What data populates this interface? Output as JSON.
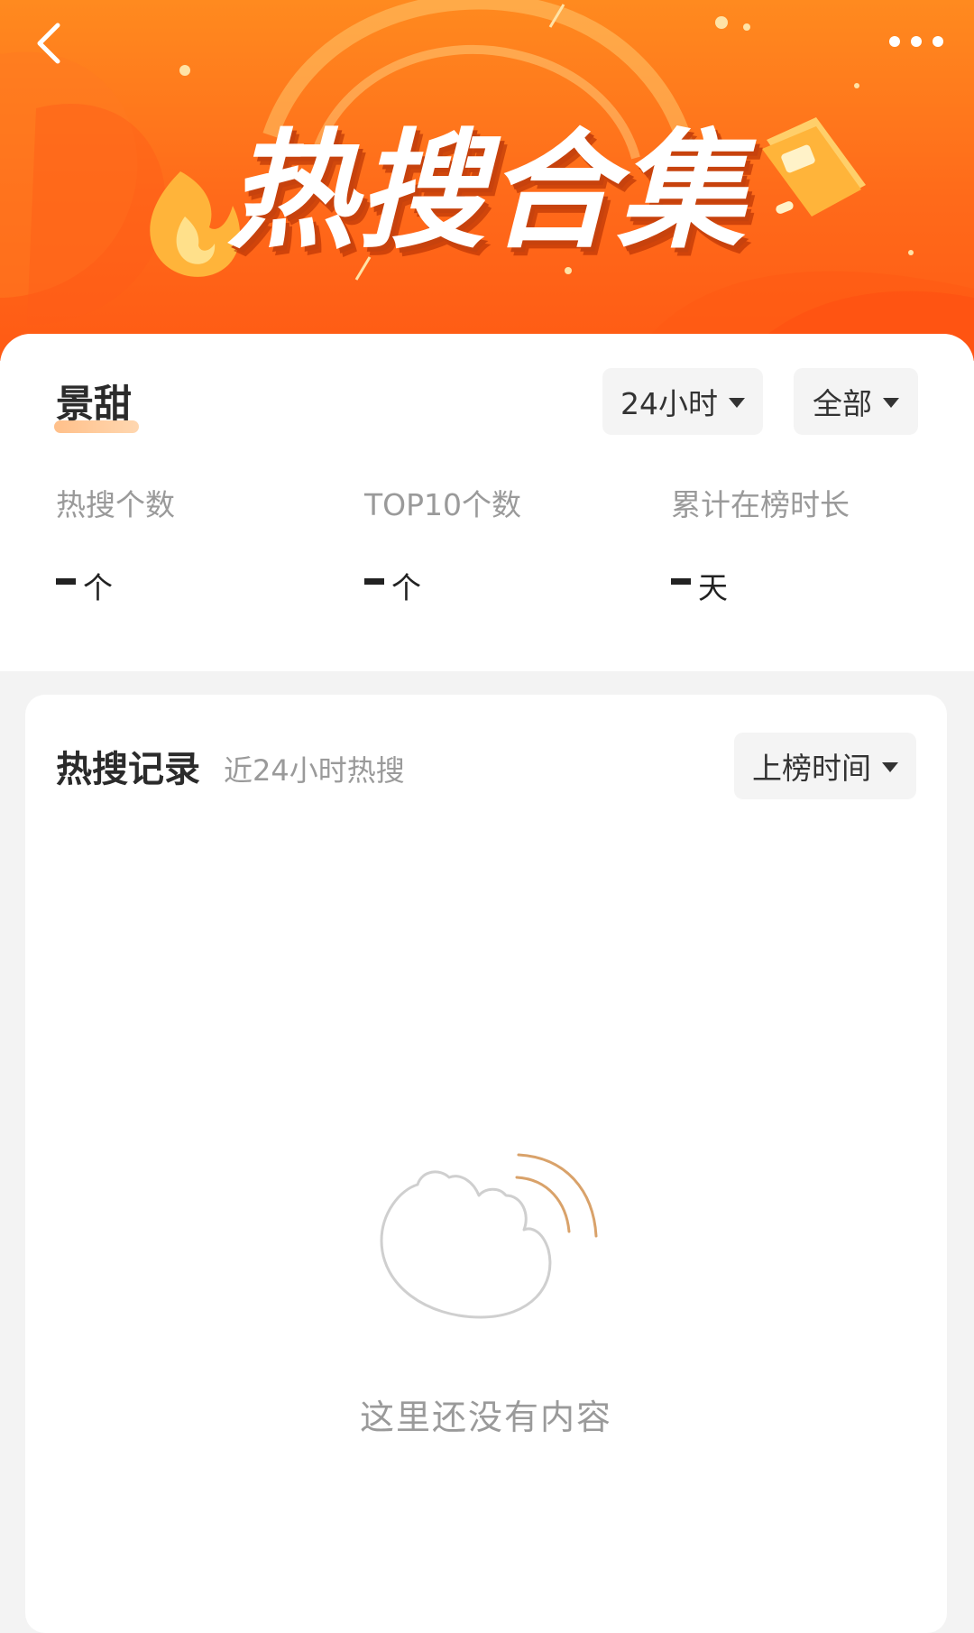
{
  "colors": {
    "brand_orange": "#ff6a1a",
    "banner_light": "#ff8a1f",
    "text_primary": "#222222",
    "text_secondary": "#9a9a9a",
    "dropdown_bg": "#f4f4f4",
    "illustration_accent": "#d9a26a"
  },
  "header": {
    "back_icon": "chevron-left-icon",
    "more_icon": "more-dots-icon",
    "title": "热搜合集"
  },
  "topic": {
    "name": "景甜"
  },
  "filters": {
    "time_range": "24小时",
    "scope": "全部"
  },
  "stats": [
    {
      "label": "热搜个数",
      "value": "-",
      "unit": "个"
    },
    {
      "label": "TOP10个数",
      "value": "-",
      "unit": "个"
    },
    {
      "label": "累计在榜时长",
      "value": "-",
      "unit": "天"
    }
  ],
  "records": {
    "title": "热搜记录",
    "subtitle": "近24小时热搜",
    "sort_label": "上榜时间",
    "empty_icon": "empty-content-icon",
    "empty_text": "这里还没有内容"
  }
}
